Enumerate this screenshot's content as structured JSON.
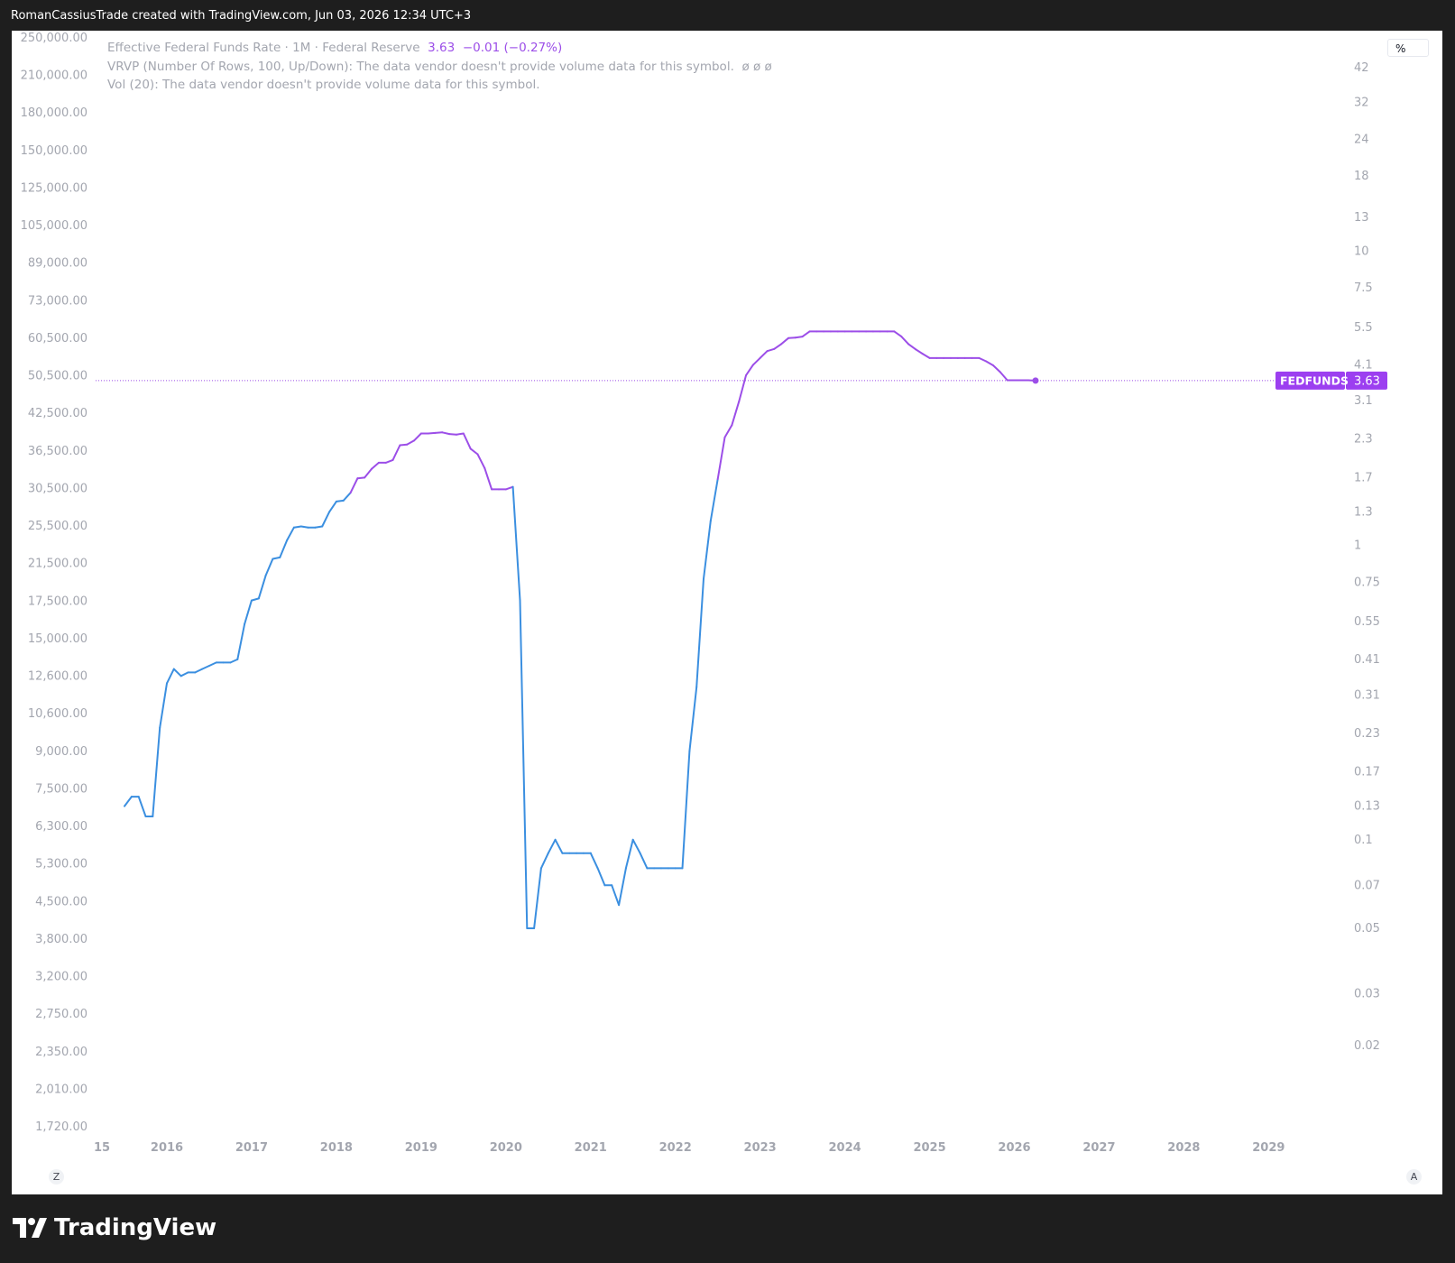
{
  "header": {
    "attribution": "RomanCassiusTrade created with TradingView.com, Jun 03, 2026 12:34 UTC+3"
  },
  "legend": {
    "symbol_desc": "Effective Federal Funds Rate · 1M · Federal Reserve",
    "last_value": "3.63",
    "change": "−0.01 (−0.27%)",
    "vrvp": "VRVP (Number Of Rows, 100, Up/Down): The data vendor doesn't provide volume data for this symbol.",
    "vrvp_flags": "ø  ø  ø",
    "vol": "Vol (20): The data vendor doesn't provide volume data for this symbol."
  },
  "buttons": {
    "percent": "%",
    "z": "Z",
    "a": "A"
  },
  "price_tag": {
    "symbol": "FEDFUNDS",
    "value": "3.63"
  },
  "brand": {
    "name": "TradingView"
  },
  "colors": {
    "line_up": "#9c4ee8",
    "line_down": "#3b8fe0",
    "axis_text": "#a3a6af",
    "tag_bg": "#9c3ff0"
  },
  "chart_data": {
    "type": "line",
    "series": [
      {
        "name": "FEDFUNDS",
        "values": []
      }
    ],
    "x": [
      "2015-07",
      "2015-08",
      "2015-09",
      "2015-10",
      "2015-11",
      "2015-12",
      "2016-01",
      "2016-02",
      "2016-03",
      "2016-04",
      "2016-05",
      "2016-06",
      "2016-07",
      "2016-08",
      "2016-09",
      "2016-10",
      "2016-11",
      "2016-12",
      "2017-01",
      "2017-02",
      "2017-03",
      "2017-04",
      "2017-05",
      "2017-06",
      "2017-07",
      "2017-08",
      "2017-09",
      "2017-10",
      "2017-11",
      "2017-12",
      "2018-01",
      "2018-02",
      "2018-03",
      "2018-04",
      "2018-05",
      "2018-06",
      "2018-07",
      "2018-08",
      "2018-09",
      "2018-10",
      "2018-11",
      "2018-12",
      "2019-01",
      "2019-02",
      "2019-03",
      "2019-04",
      "2019-05",
      "2019-06",
      "2019-07",
      "2019-08",
      "2019-09",
      "2019-10",
      "2019-11",
      "2019-12",
      "2020-01",
      "2020-02",
      "2020-03",
      "2020-04",
      "2020-05",
      "2020-06",
      "2020-07",
      "2020-08",
      "2020-09",
      "2020-10",
      "2020-11",
      "2020-12",
      "2021-01",
      "2021-02",
      "2021-03",
      "2021-04",
      "2021-05",
      "2021-06",
      "2021-07",
      "2021-08",
      "2021-09",
      "2021-10",
      "2021-11",
      "2021-12",
      "2022-01",
      "2022-02",
      "2022-03",
      "2022-04",
      "2022-05",
      "2022-06",
      "2022-07",
      "2022-08",
      "2022-09",
      "2022-10",
      "2022-11",
      "2022-12",
      "2023-01",
      "2023-02",
      "2023-03",
      "2023-04",
      "2023-05",
      "2023-06",
      "2023-07",
      "2023-08",
      "2023-09",
      "2023-10",
      "2023-11",
      "2023-12",
      "2024-01",
      "2024-02",
      "2024-03",
      "2024-04",
      "2024-05",
      "2024-06",
      "2024-07",
      "2024-08",
      "2024-09",
      "2024-10",
      "2024-11",
      "2024-12",
      "2025-01",
      "2025-02",
      "2025-03",
      "2025-04",
      "2025-05",
      "2025-06",
      "2025-07",
      "2025-08",
      "2025-09",
      "2025-10",
      "2025-11",
      "2025-12",
      "2026-01",
      "2026-02",
      "2026-03",
      "2026-04"
    ],
    "y": [
      0.13,
      0.14,
      0.14,
      0.12,
      0.12,
      0.24,
      0.34,
      0.38,
      0.36,
      0.37,
      0.37,
      0.38,
      0.39,
      0.4,
      0.4,
      0.4,
      0.41,
      0.54,
      0.65,
      0.66,
      0.79,
      0.9,
      0.91,
      1.04,
      1.15,
      1.16,
      1.15,
      1.15,
      1.16,
      1.3,
      1.41,
      1.42,
      1.51,
      1.69,
      1.7,
      1.82,
      1.91,
      1.91,
      1.95,
      2.19,
      2.2,
      2.27,
      2.4,
      2.4,
      2.41,
      2.42,
      2.39,
      2.38,
      2.4,
      2.13,
      2.04,
      1.83,
      1.55,
      1.55,
      1.55,
      1.58,
      0.65,
      0.05,
      0.05,
      0.08,
      0.09,
      0.1,
      0.09,
      0.09,
      0.09,
      0.09,
      0.09,
      0.08,
      0.07,
      0.07,
      0.06,
      0.08,
      0.1,
      0.09,
      0.08,
      0.08,
      0.08,
      0.08,
      0.08,
      0.08,
      0.2,
      0.33,
      0.77,
      1.21,
      1.68,
      2.33,
      2.56,
      3.08,
      3.78,
      4.1,
      4.33,
      4.57,
      4.65,
      4.83,
      5.06,
      5.08,
      5.12,
      5.33,
      5.33,
      5.33,
      5.33,
      5.33,
      5.33,
      5.33,
      5.33,
      5.33,
      5.33,
      5.33,
      5.33,
      5.33,
      5.13,
      4.83,
      4.64,
      4.48,
      4.33,
      4.33,
      4.33,
      4.33,
      4.33,
      4.33,
      4.33,
      4.33,
      4.22,
      4.09,
      3.88,
      3.64,
      3.64,
      3.64,
      3.64,
      3.63
    ],
    "title": "Effective Federal Funds Rate · 1M · Federal Reserve",
    "x_tick_labels": [
      "15",
      "2016",
      "2017",
      "2018",
      "2019",
      "2020",
      "2021",
      "2022",
      "2023",
      "2024",
      "2025",
      "2026",
      "2027",
      "2028",
      "2029"
    ],
    "left_axis_labels": [
      "250,000.00",
      "210,000.00",
      "180,000.00",
      "150,000.00",
      "125,000.00",
      "105,000.00",
      "89,000.00",
      "73,000.00",
      "60,500.00",
      "50,500.00",
      "42,500.00",
      "36,500.00",
      "30,500.00",
      "25,500.00",
      "21,500.00",
      "17,500.00",
      "15,000.00",
      "12,600.00",
      "10,600.00",
      "9,000.00",
      "7,500.00",
      "6,300.00",
      "5,300.00",
      "4,500.00",
      "3,800.00",
      "3,200.00",
      "2,750.00",
      "2,350.00",
      "2,010.00",
      "1,720.00"
    ],
    "right_axis_labels": [
      "42",
      "32",
      "24",
      "18",
      "13",
      "10",
      "7.5",
      "5.5",
      "4.1",
      "3.1",
      "2.3",
      "1.7",
      "1.3",
      "1",
      "0.75",
      "0.55",
      "0.41",
      "0.31",
      "0.23",
      "0.17",
      "0.13",
      "0.1",
      "0.07",
      "0.05",
      "0.03",
      "0.02"
    ],
    "right_axis_unit": "%",
    "y_scale": "log",
    "ylim": [
      0.02,
      42
    ],
    "current_price_line": 3.63,
    "grid": false,
    "legend_position": "top-left"
  }
}
